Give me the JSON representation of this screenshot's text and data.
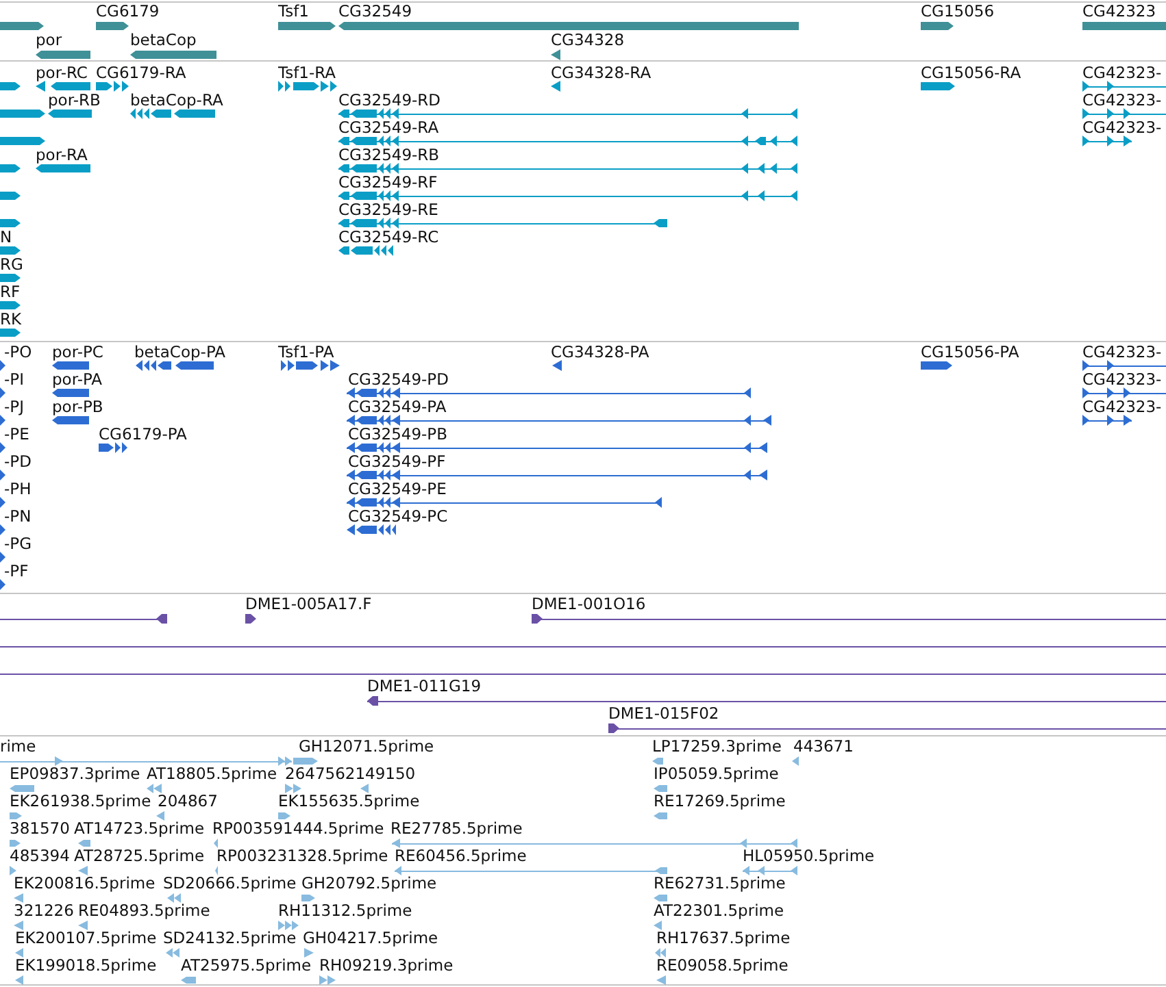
{
  "tracks": [
    {
      "kind": "gene",
      "features": [
        {
          "reverse": false
        },
        {
          "label": "CG6179",
          "reverse": false
        },
        {
          "label": "Tsf1",
          "reverse": false
        },
        {
          "label": "CG32549",
          "reverse": true
        },
        {
          "label": "CG15056",
          "reverse": false
        },
        {
          "label": "CG42323",
          "reverse": false
        },
        {
          "label": "por",
          "reverse": true
        },
        {
          "label": "betaCop",
          "reverse": true
        },
        {
          "label": "CG34328",
          "reverse": true
        }
      ]
    },
    {
      "kind": "transcript",
      "features": [
        {
          "reverse": false
        },
        {
          "label": "por-RC",
          "reverse": true
        },
        {
          "label": "CG6179-RA",
          "reverse": false
        },
        {
          "label": "Tsf1-RA",
          "reverse": false
        },
        {
          "label": "CG34328-RA",
          "reverse": true
        },
        {
          "label": "CG15056-RA",
          "reverse": false
        },
        {
          "label": "CG42323-",
          "reverse": false
        },
        {
          "reverse": false
        },
        {
          "label": "por-RB",
          "reverse": true
        },
        {
          "label": "betaCop-RA",
          "reverse": true
        },
        {
          "label": "CG32549-RD",
          "reverse": true
        },
        {
          "label": "CG42323-",
          "reverse": false
        },
        {
          "reverse": false
        },
        {
          "label": "CG32549-RA",
          "reverse": true
        },
        {
          "label": "CG42323-",
          "reverse": false
        },
        {
          "reverse": false
        },
        {
          "label": "por-RA",
          "reverse": true
        },
        {
          "label": "CG32549-RB",
          "reverse": true
        },
        {
          "reverse": false
        },
        {
          "label": "CG32549-RF",
          "reverse": true
        },
        {
          "reverse": false
        },
        {
          "label": "CG32549-RE",
          "reverse": true
        },
        {
          "label": "N",
          "reverse": false
        },
        {
          "label": "CG32549-RC",
          "reverse": true
        },
        {
          "label": "RG",
          "reverse": false
        },
        {
          "label": "RF",
          "reverse": false
        },
        {
          "label": "RK",
          "reverse": false
        }
      ]
    },
    {
      "kind": "protein",
      "features": [
        {
          "label": "-PO",
          "reverse": false
        },
        {
          "label": "por-PC",
          "reverse": true
        },
        {
          "label": "betaCop-PA",
          "reverse": true
        },
        {
          "label": "Tsf1-PA",
          "reverse": false
        },
        {
          "label": "CG34328-PA",
          "reverse": true
        },
        {
          "label": "CG15056-PA",
          "reverse": false
        },
        {
          "label": "CG42323-",
          "reverse": false
        },
        {
          "label": "-PI",
          "reverse": false
        },
        {
          "label": "por-PA",
          "reverse": true
        },
        {
          "label": "CG32549-PD",
          "reverse": true
        },
        {
          "label": "CG42323-",
          "reverse": false
        },
        {
          "label": "-PJ",
          "reverse": false
        },
        {
          "label": "por-PB",
          "reverse": true
        },
        {
          "label": "CG32549-PA",
          "reverse": true
        },
        {
          "label": "CG42323-",
          "reverse": false
        },
        {
          "label": "-PE",
          "reverse": false
        },
        {
          "label": "CG6179-PA",
          "reverse": false
        },
        {
          "label": "CG32549-PB",
          "reverse": true
        },
        {
          "label": "-PD",
          "reverse": false
        },
        {
          "label": "CG32549-PF",
          "reverse": true
        },
        {
          "label": "-PH",
          "reverse": false
        },
        {
          "label": "CG32549-PE",
          "reverse": true
        },
        {
          "label": "-PN",
          "reverse": false
        },
        {
          "label": "CG32549-PC",
          "reverse": true
        },
        {
          "label": "-PG",
          "reverse": false
        },
        {
          "label": "-PF",
          "reverse": false
        }
      ]
    },
    {
      "kind": "clone",
      "features": [
        {
          "kind": "arrow",
          "reverse": true
        },
        {
          "kind": "arrow",
          "label": "DME1-005A17.F",
          "reverse": false
        },
        {
          "kind": "arrow",
          "label": "DME1-001O16",
          "reverse": false
        },
        {
          "kind": "line"
        },
        {
          "kind": "line"
        },
        {
          "kind": "arrow",
          "label": "DME1-011G19",
          "reverse": true
        },
        {
          "kind": "arrow",
          "label": "DME1-015F02",
          "reverse": false
        }
      ]
    },
    {
      "kind": "est",
      "features": [
        {
          "label": "rime",
          "reverse": false
        },
        {
          "label": "GH12071.5prime",
          "reverse": false
        },
        {
          "label": "LP17259.3prime",
          "reverse": true
        },
        {
          "label": "443671",
          "reverse": true
        },
        {
          "label": "EP09837.3prime",
          "reverse": true
        },
        {
          "label": "AT18805.5prime",
          "reverse": true
        },
        {
          "label": "2647562149150",
          "reverse": false
        },
        {
          "reverse": true
        },
        {
          "label": "IP05059.5prime",
          "reverse": true
        },
        {
          "label": "EK261938.5prime",
          "reverse": false
        },
        {
          "label": "204867",
          "reverse": true
        },
        {
          "label": "EK155635.5prime",
          "reverse": false
        },
        {
          "label": "RE17269.5prime",
          "reverse": true
        },
        {
          "label": "381570",
          "reverse": false
        },
        {
          "label": "AT14723.5prime",
          "reverse": true
        },
        {
          "label": "RP003591444.5prime",
          "reverse": true
        },
        {
          "label": "RE27785.5prime",
          "reverse": true
        },
        {
          "label": "485394",
          "reverse": false
        },
        {
          "label": "AT28725.5prime",
          "reverse": true
        },
        {
          "label": "RP003231328.5prime",
          "reverse": true
        },
        {
          "label": "RE60456.5prime",
          "reverse": true
        },
        {
          "label": "HL05950.5prime",
          "reverse": true
        },
        {
          "label": "EK200816.5prime",
          "reverse": true
        },
        {
          "label": "SD20666.5prime",
          "reverse": true
        },
        {
          "label": "GH20792.5prime",
          "reverse": false
        },
        {
          "label": "RE62731.5prime",
          "reverse": true
        },
        {
          "label": "321226",
          "reverse": true
        },
        {
          "label": "RE04893.5prime",
          "reverse": true
        },
        {
          "label": "RH11312.5prime",
          "reverse": false
        },
        {
          "label": "AT22301.5prime",
          "reverse": true
        },
        {
          "label": "EK200107.5prime",
          "reverse": true
        },
        {
          "label": "SD24132.5prime",
          "reverse": true
        },
        {
          "label": "GH04217.5prime",
          "reverse": false
        },
        {
          "label": "RH17637.5prime",
          "reverse": true
        },
        {
          "label": "EK199018.5prime",
          "reverse": true
        },
        {
          "label": "AT25975.5prime",
          "reverse": true
        },
        {
          "label": "RH09219.3prime",
          "reverse": false
        },
        {
          "label": "RE09058.5prime",
          "reverse": true
        }
      ]
    }
  ]
}
